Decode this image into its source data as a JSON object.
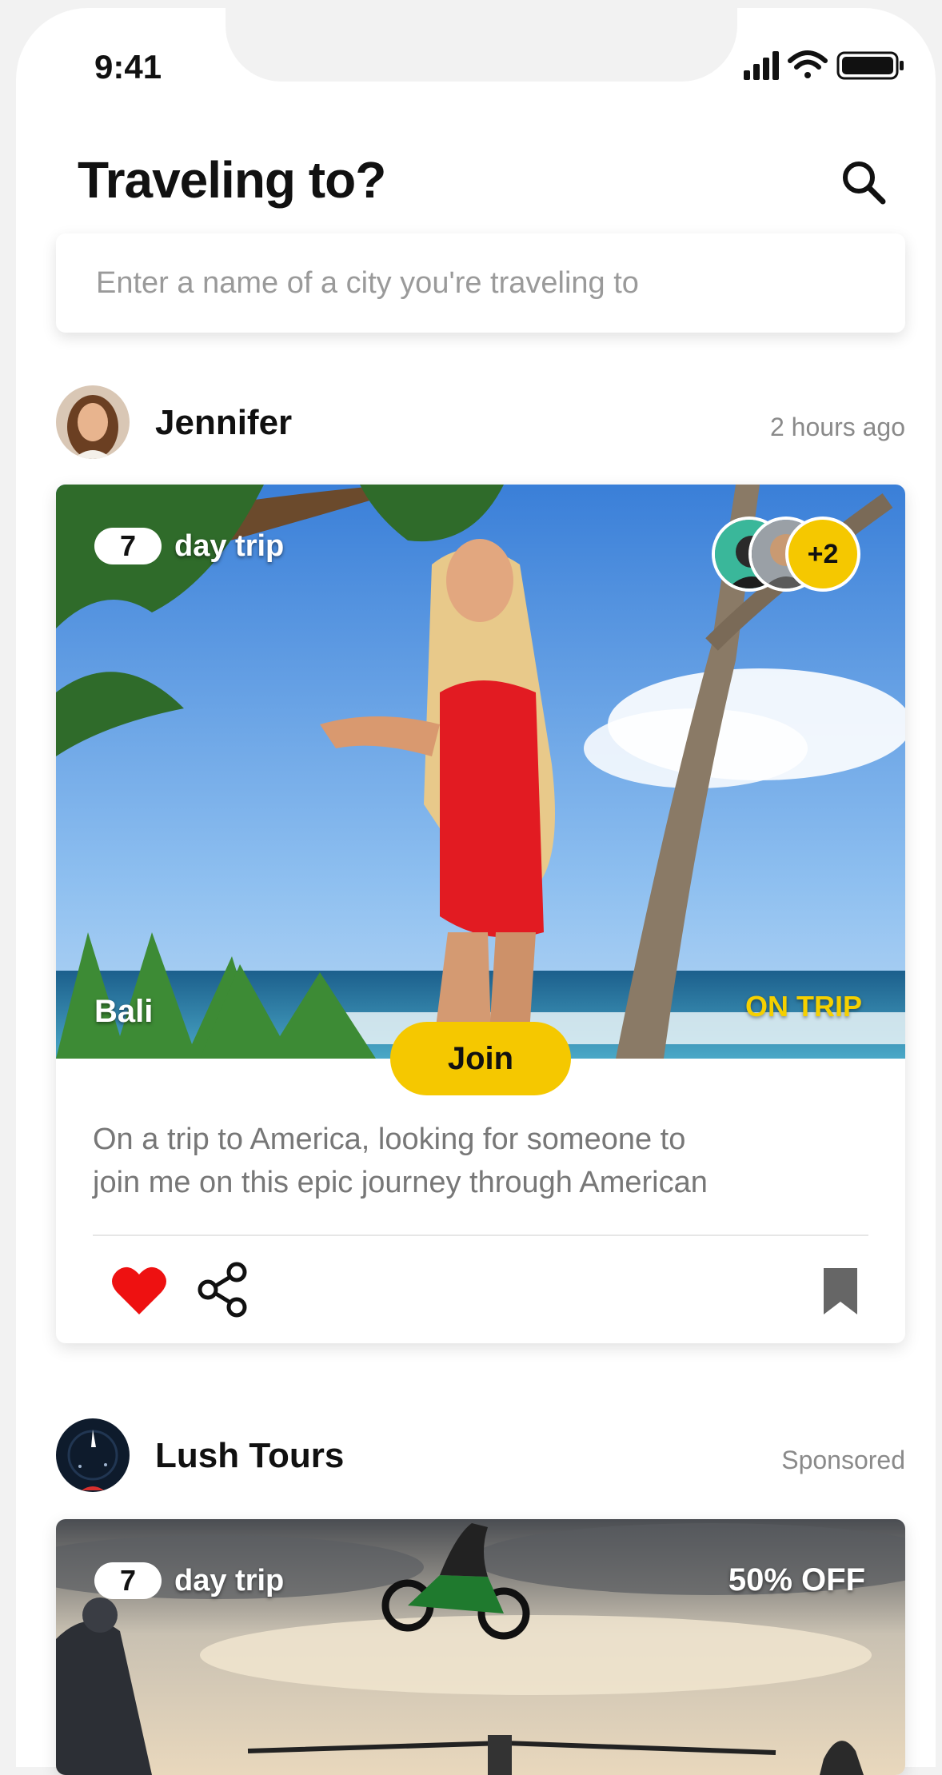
{
  "status_bar": {
    "time": "9:41"
  },
  "header": {
    "title": "Traveling to?"
  },
  "search": {
    "placeholder": "Enter a name of a city you're traveling to"
  },
  "colors": {
    "accent": "#f5c800",
    "heart": "#ee1111",
    "bookmark": "#666666"
  },
  "posts": [
    {
      "author": "Jennifer",
      "meta": "2 hours ago",
      "trip_days": "7",
      "trip_label": "day trip",
      "participants_more": "+2",
      "location": "Bali",
      "status": "ON TRIP",
      "join_label": "Join",
      "description_line1": "On a trip to America, looking for someone to",
      "description_line2": "join me on this epic journey through American",
      "icons": [
        "heart-icon",
        "share-icon",
        "bookmark-icon"
      ]
    },
    {
      "author": "Lush Tours",
      "meta": "Sponsored",
      "trip_days": "7",
      "trip_label": "day trip",
      "discount": "50% OFF"
    }
  ]
}
